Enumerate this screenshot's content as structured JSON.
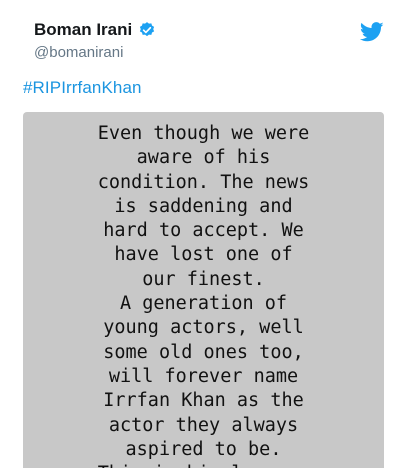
{
  "tweet": {
    "author_name": "Boman Irani",
    "author_handle": "@bomanirani",
    "hashtag": "#RIPIrrfanKhan",
    "image_text": "Even though we were\naware of his\ncondition. The news\nis saddening and\nhard to accept. We\nhave lost one of\nour finest.\nA generation of\nyoung actors, well\nsome old ones too,\nwill forever name\nIrrfan Khan as the\nactor they always\naspired to be.\nThis is his legacy."
  },
  "colors": {
    "twitter_blue": "#1da1f2",
    "hashtag_blue": "#1b95e0",
    "image_background": "#c8c8c8"
  },
  "icons": [
    "verified-badge-icon",
    "twitter-bird-icon"
  ]
}
